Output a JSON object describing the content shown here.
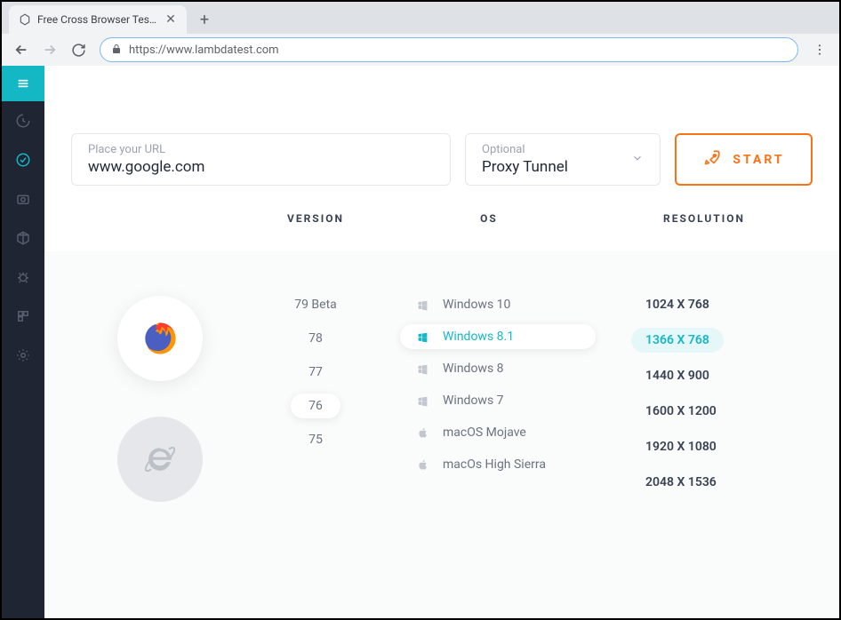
{
  "browser_tab": {
    "title": "Free Cross Browser Testing Clou",
    "url": "https://www.lambdatest.com"
  },
  "form": {
    "url_placeholder": "Place your URL",
    "url_value": "www.google.com",
    "proxy_label": "Optional",
    "proxy_value": "Proxy Tunnel",
    "start_label": "START"
  },
  "headers": {
    "version": "VERSION",
    "os": "OS",
    "resolution": "RESOLUTION"
  },
  "versions": [
    {
      "label": "79 Beta",
      "selected": false
    },
    {
      "label": "78",
      "selected": false
    },
    {
      "label": "77",
      "selected": false
    },
    {
      "label": "76",
      "selected": true
    },
    {
      "label": "75",
      "selected": false
    }
  ],
  "os_list": [
    {
      "label": "Windows 10",
      "platform": "windows",
      "selected": false
    },
    {
      "label": "Windows 8.1",
      "platform": "windows",
      "selected": true
    },
    {
      "label": "Windows 8",
      "platform": "windows",
      "selected": false
    },
    {
      "label": "Windows 7",
      "platform": "windows",
      "selected": false
    },
    {
      "label": "macOS Mojave",
      "platform": "mac",
      "selected": false
    },
    {
      "label": "macOs High Sierra",
      "platform": "mac",
      "selected": false
    }
  ],
  "resolutions": [
    {
      "label": "1024 X 768",
      "selected": false
    },
    {
      "label": "1366 X 768",
      "selected": true
    },
    {
      "label": "1440 X 900",
      "selected": false
    },
    {
      "label": "1600 X 1200",
      "selected": false
    },
    {
      "label": "1920 X 1080",
      "selected": false
    },
    {
      "label": "2048 X 1536",
      "selected": false
    }
  ],
  "colors": {
    "accent_teal": "#14b8c5",
    "accent_orange": "#f97316",
    "sidebar_bg": "#1f2532"
  }
}
